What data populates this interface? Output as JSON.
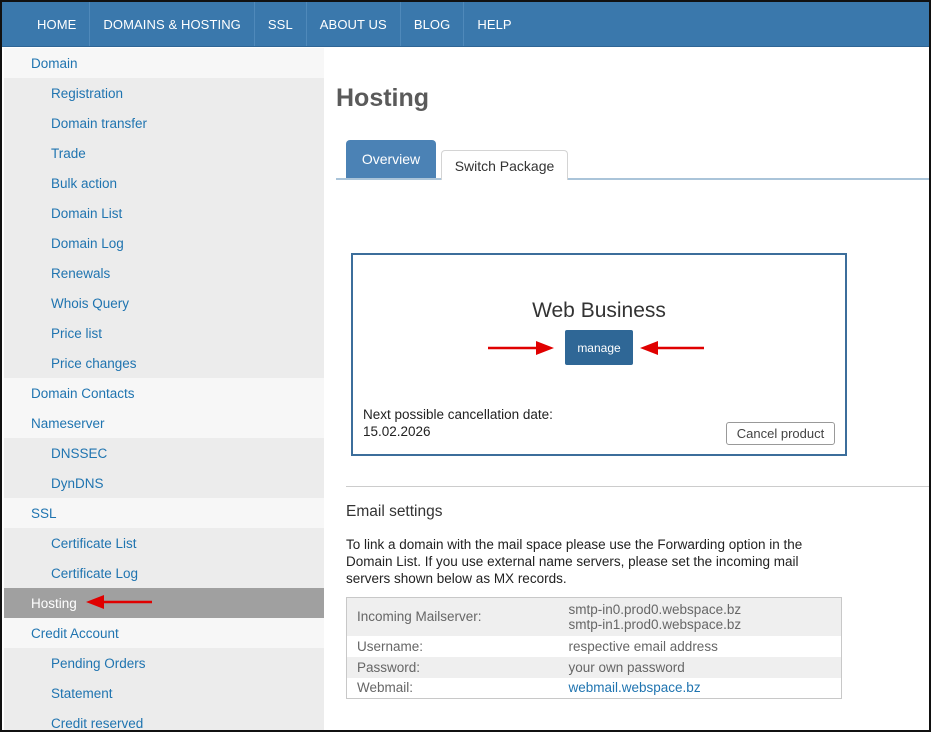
{
  "nav": {
    "items": [
      "HOME",
      "DOMAINS & HOSTING",
      "SSL",
      "ABOUT US",
      "BLOG",
      "HELP"
    ]
  },
  "sidebar": {
    "items": [
      {
        "label": "Domain",
        "level": 1
      },
      {
        "label": "Registration",
        "level": 2
      },
      {
        "label": "Domain transfer",
        "level": 2
      },
      {
        "label": "Trade",
        "level": 2
      },
      {
        "label": "Bulk action",
        "level": 2
      },
      {
        "label": "Domain List",
        "level": 2
      },
      {
        "label": "Domain Log",
        "level": 2
      },
      {
        "label": "Renewals",
        "level": 2
      },
      {
        "label": "Whois Query",
        "level": 2
      },
      {
        "label": "Price list",
        "level": 2
      },
      {
        "label": "Price changes",
        "level": 2
      },
      {
        "label": "Domain Contacts",
        "level": 1
      },
      {
        "label": "Nameserver",
        "level": 1
      },
      {
        "label": "DNSSEC",
        "level": 2
      },
      {
        "label": "DynDNS",
        "level": 2
      },
      {
        "label": "SSL",
        "level": 1
      },
      {
        "label": "Certificate List",
        "level": 2
      },
      {
        "label": "Certificate Log",
        "level": 2
      },
      {
        "label": "Hosting",
        "level": 1,
        "active": true
      },
      {
        "label": "Credit Account",
        "level": 1
      },
      {
        "label": "Pending Orders",
        "level": 2
      },
      {
        "label": "Statement",
        "level": 2
      },
      {
        "label": "Credit reserved",
        "level": 2
      }
    ]
  },
  "main": {
    "title": "Hosting",
    "tabs": {
      "overview": "Overview",
      "switch_package": "Switch Package"
    },
    "product": {
      "name": "Web Business",
      "manage_label": "manage",
      "cancel_date_label": "Next possible cancellation date:",
      "cancel_date": "15.02.2026",
      "cancel_button": "Cancel product"
    },
    "email": {
      "title": "Email settings",
      "description": "To link a domain with the mail space please use the Forwarding option in the Domain List. If you use external name servers, please set the incoming mail servers shown below as MX records.",
      "rows": {
        "incoming_label": "Incoming Mailserver:",
        "incoming_value_1": "smtp-in0.prod0.webspace.bz",
        "incoming_value_2": "smtp-in1.prod0.webspace.bz",
        "username_label": "Username:",
        "username_value": "respective email address",
        "password_label": "Password:",
        "password_value": "your own password",
        "webmail_label": "Webmail:",
        "webmail_value": "webmail.webspace.bz"
      }
    }
  },
  "colors": {
    "nav_bg": "#3a78ac",
    "link": "#1f74b0",
    "active_sidebar": "#a0a0a0",
    "button": "#2f6796",
    "annotation_arrow": "#e00000"
  }
}
